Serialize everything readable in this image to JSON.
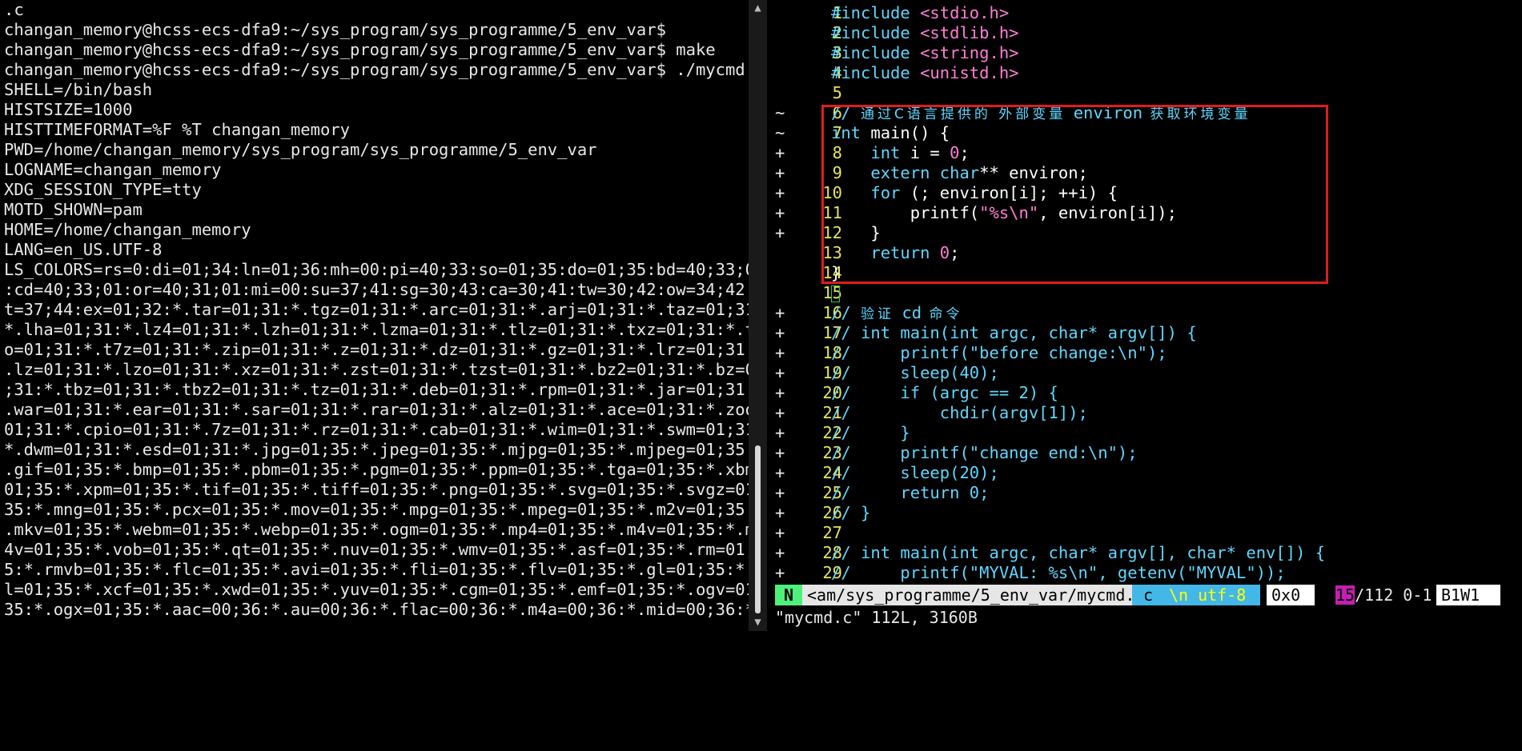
{
  "terminal": {
    "lines": [
      ".c",
      "changan_memory@hcss-ecs-dfa9:~/sys_program/sys_programme/5_env_var$",
      "changan_memory@hcss-ecs-dfa9:~/sys_program/sys_programme/5_env_var$ make",
      "changan_memory@hcss-ecs-dfa9:~/sys_program/sys_programme/5_env_var$ ./mycmd",
      "SHELL=/bin/bash",
      "HISTSIZE=1000",
      "HISTTIMEFORMAT=%F %T changan_memory",
      "PWD=/home/changan_memory/sys_program/sys_programme/5_env_var",
      "LOGNAME=changan_memory",
      "XDG_SESSION_TYPE=tty",
      "MOTD_SHOWN=pam",
      "HOME=/home/changan_memory",
      "LANG=en_US.UTF-8",
      "LS_COLORS=rs=0:di=01;34:ln=01;36:mh=00:pi=40;33:so=01;35:do=01;35:bd=40;33;01",
      ":cd=40;33;01:or=40;31;01:mi=00:su=37;41:sg=30;43:ca=30;41:tw=30;42:ow=34;42:s",
      "t=37;44:ex=01;32:*.tar=01;31:*.tgz=01;31:*.arc=01;31:*.arj=01;31:*.taz=01;31:",
      "*.lha=01;31:*.lz4=01;31:*.lzh=01;31:*.lzma=01;31:*.tlz=01;31:*.txz=01;31:*.tz",
      "o=01;31:*.t7z=01;31:*.zip=01;31:*.z=01;31:*.dz=01;31:*.gz=01;31:*.lrz=01;31:*",
      ".lz=01;31:*.lzo=01;31:*.xz=01;31:*.zst=01;31:*.tzst=01;31:*.bz2=01;31:*.bz=01",
      ";31:*.tbz=01;31:*.tbz2=01;31:*.tz=01;31:*.deb=01;31:*.rpm=01;31:*.jar=01;31:*",
      ".war=01;31:*.ear=01;31:*.sar=01;31:*.rar=01;31:*.alz=01;31:*.ace=01;31:*.zoo=",
      "01;31:*.cpio=01;31:*.7z=01;31:*.rz=01;31:*.cab=01;31:*.wim=01;31:*.swm=01;31:",
      "*.dwm=01;31:*.esd=01;31:*.jpg=01;35:*.jpeg=01;35:*.mjpg=01;35:*.mjpeg=01;35:*",
      ".gif=01;35:*.bmp=01;35:*.pbm=01;35:*.pgm=01;35:*.ppm=01;35:*.tga=01;35:*.xbm=",
      "01;35:*.xpm=01;35:*.tif=01;35:*.tiff=01;35:*.png=01;35:*.svg=01;35:*.svgz=01;",
      "35:*.mng=01;35:*.pcx=01;35:*.mov=01;35:*.mpg=01;35:*.mpeg=01;35:*.m2v=01;35:*",
      ".mkv=01;35:*.webm=01;35:*.webp=01;35:*.ogm=01;35:*.mp4=01;35:*.m4v=01;35:*.mp",
      "4v=01;35:*.vob=01;35:*.qt=01;35:*.nuv=01;35:*.wmv=01;35:*.asf=01;35:*.rm=01;3",
      "5:*.rmvb=01;35:*.flc=01;35:*.avi=01;35:*.fli=01;35:*.flv=01;35:*.gl=01;35:*.d",
      "l=01;35:*.xcf=01;35:*.xwd=01;35:*.yuv=01;35:*.cgm=01;35:*.emf=01;35:*.ogv=01;",
      "35:*.ogx=01;35:*.aac=00;36:*.au=00;36:*.flac=00;36:*.m4a=00;36:*.mid=00;36:*."
    ],
    "scroll_up_glyph": "▲",
    "scroll_down_glyph": "▼",
    "scroll_position": 0.82
  },
  "editor": {
    "lines": [
      {
        "sign": "",
        "num": "1",
        "tokens": [
          [
            "kw",
            "#include "
          ],
          [
            "str",
            "<stdio.h>"
          ]
        ]
      },
      {
        "sign": "",
        "num": "2",
        "tokens": [
          [
            "kw",
            "#include "
          ],
          [
            "str",
            "<stdlib.h>"
          ]
        ]
      },
      {
        "sign": "",
        "num": "3",
        "tokens": [
          [
            "kw",
            "#include "
          ],
          [
            "str",
            "<string.h>"
          ]
        ]
      },
      {
        "sign": "",
        "num": "4",
        "tokens": [
          [
            "kw",
            "#include "
          ],
          [
            "str",
            "<unistd.h>"
          ]
        ]
      },
      {
        "sign": "",
        "num": "5",
        "tokens": []
      },
      {
        "sign": "~",
        "num": "6",
        "tokens": [
          [
            "cmt",
            "// "
          ],
          [
            "cmtzh",
            "通过C语言提供的 外部变量 "
          ],
          [
            "cmt",
            "environ"
          ],
          [
            "cmtzh",
            " 获取环境变量"
          ]
        ]
      },
      {
        "sign": "~",
        "num": "7",
        "tokens": [
          [
            "kw",
            "int"
          ],
          [
            "id",
            " main() {"
          ]
        ]
      },
      {
        "sign": "+",
        "num": "8",
        "tokens": [
          [
            "id",
            "    "
          ],
          [
            "kw",
            "int"
          ],
          [
            "id",
            " i = "
          ],
          [
            "num",
            "0"
          ],
          [
            "id",
            ";"
          ]
        ]
      },
      {
        "sign": "+",
        "num": "9",
        "tokens": [
          [
            "id",
            "    "
          ],
          [
            "kw",
            "extern char"
          ],
          [
            "id",
            "** environ;"
          ]
        ]
      },
      {
        "sign": "+",
        "num": "10",
        "tokens": [
          [
            "id",
            "    "
          ],
          [
            "kw",
            "for"
          ],
          [
            "id",
            " (; environ[i]; ++i) {"
          ]
        ]
      },
      {
        "sign": "+",
        "num": "11",
        "tokens": [
          [
            "id",
            "        printf("
          ],
          [
            "str",
            "\"%s\\n\""
          ],
          [
            "id",
            ", environ[i]);"
          ]
        ]
      },
      {
        "sign": "+",
        "num": "12",
        "tokens": [
          [
            "id",
            "    }"
          ]
        ]
      },
      {
        "sign": "",
        "num": "13",
        "tokens": [
          [
            "id",
            "    "
          ],
          [
            "kw",
            "return"
          ],
          [
            "id",
            " "
          ],
          [
            "num",
            "0"
          ],
          [
            "id",
            ";"
          ]
        ]
      },
      {
        "sign": "",
        "num": "14",
        "tokens": [
          [
            "id",
            "}"
          ]
        ]
      },
      {
        "sign": "",
        "num": "15",
        "tokens": [
          [
            "cursor",
            ""
          ]
        ]
      },
      {
        "sign": "+",
        "num": "16",
        "tokens": [
          [
            "cmt",
            "// "
          ],
          [
            "cmtzh",
            "验证 "
          ],
          [
            "cmt",
            "cd"
          ],
          [
            "cmtzh",
            " 命令"
          ]
        ]
      },
      {
        "sign": "+",
        "num": "17",
        "tokens": [
          [
            "cmt",
            "// int main(int argc, char* argv[]) {"
          ]
        ]
      },
      {
        "sign": "+",
        "num": "18",
        "tokens": [
          [
            "cmt",
            "//     printf(\"before change:\\n\");"
          ]
        ]
      },
      {
        "sign": "+",
        "num": "19",
        "tokens": [
          [
            "cmt",
            "//     sleep(40);"
          ]
        ]
      },
      {
        "sign": "+",
        "num": "20",
        "tokens": [
          [
            "cmt",
            "//     if (argc == 2) {"
          ]
        ]
      },
      {
        "sign": "+",
        "num": "21",
        "tokens": [
          [
            "cmt",
            "//         chdir(argv[1]);"
          ]
        ]
      },
      {
        "sign": "+",
        "num": "22",
        "tokens": [
          [
            "cmt",
            "//     }"
          ]
        ]
      },
      {
        "sign": "+",
        "num": "23",
        "tokens": [
          [
            "cmt",
            "//     printf(\"change end:\\n\");"
          ]
        ]
      },
      {
        "sign": "+",
        "num": "24",
        "tokens": [
          [
            "cmt",
            "//     sleep(20);"
          ]
        ]
      },
      {
        "sign": "+",
        "num": "25",
        "tokens": [
          [
            "cmt",
            "//     return 0;"
          ]
        ]
      },
      {
        "sign": "+",
        "num": "26",
        "tokens": [
          [
            "cmt",
            "// }"
          ]
        ]
      },
      {
        "sign": "+",
        "num": "27",
        "tokens": []
      },
      {
        "sign": "+",
        "num": "28",
        "tokens": [
          [
            "cmt",
            "// int main(int argc, char* argv[], char* env[]) {"
          ]
        ]
      },
      {
        "sign": "+",
        "num": "29",
        "tokens": [
          [
            "cmt",
            "//     printf(\"MYVAL: %s\\n\", getenv(\"MYVAL\"));"
          ]
        ]
      }
    ],
    "status": {
      "mode": "N",
      "file": "<am/sys_programme/5_env_var/mycmd.c",
      "filetype": "c",
      "encoding": "\\n utf-8",
      "hex": "0x0",
      "line": "15",
      "position_rest": "/112 0-1",
      "buffer": "B1W1"
    },
    "cmdline": "\"mycmd.c\" 112L, 3160B"
  },
  "colors": {
    "highlight_box": "#e01c1c",
    "mode_bg": "#4ef07a",
    "filetype_bg": "#43b7e8",
    "line_number": "#e8e35a"
  }
}
